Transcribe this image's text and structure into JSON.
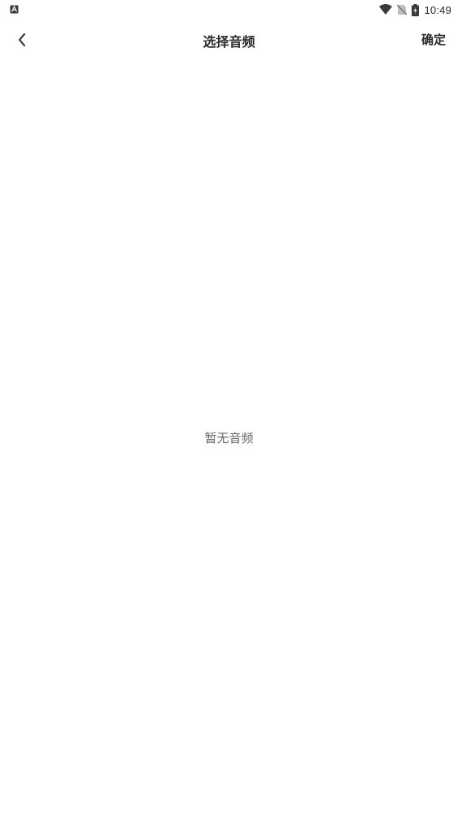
{
  "status_bar": {
    "time": "10:49",
    "left_icon": "app-notification-icon",
    "icons": [
      "wifi-icon",
      "no-sim-icon",
      "battery-charging-icon"
    ]
  },
  "header": {
    "back_icon": "chevron-left-icon",
    "title": "选择音频",
    "confirm_label": "确定"
  },
  "main": {
    "empty_text": "暂无音频"
  },
  "colors": {
    "background": "#ffffff",
    "text_primary": "#2a2a2a",
    "text_secondary": "#666666"
  }
}
